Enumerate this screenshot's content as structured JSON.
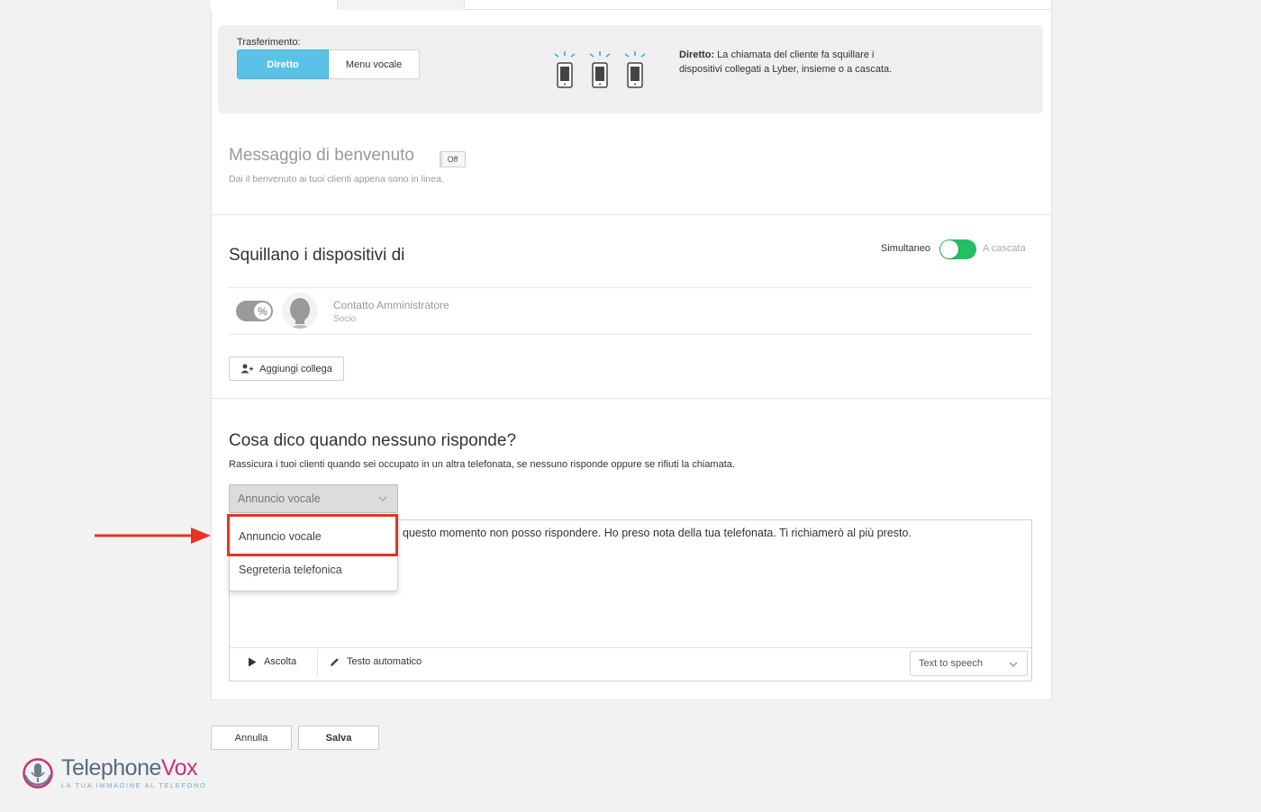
{
  "transfer": {
    "label": "Trasferimento:",
    "options": [
      "Diretto",
      "Menu vocale"
    ],
    "selected": "Diretto",
    "description_bold": "Diretto:",
    "description_rest": " La chiamata del cliente fa squillare i dispositivi collegati a Lyber, insieme o a cascata."
  },
  "welcome": {
    "title": "Messaggio di benvenuto",
    "toggle_label": "Off",
    "subtitle": "Dai il benvenuto ai tuoi clienti appena sono in linea."
  },
  "ring": {
    "title": "Squillano i dispositivi di",
    "mode_left": "Simultaneo",
    "mode_right": "A cascata",
    "simultaneous_on": true,
    "contact": {
      "name": "Contatto Amministratore",
      "role": "Socio"
    },
    "add_button": "Aggiungi collega"
  },
  "no_answer": {
    "title": "Cosa dico quando nessuno risponde?",
    "subtitle": "Rassicura i tuoi clienti quando sei occupato in un altra telefonata, se nessuno risponde oppure se rifiuti la chiamata.",
    "select_value": "Annuncio vocale",
    "dropdown_options": [
      "Annuncio vocale",
      "Segreteria telefonica"
    ],
    "message_text": "questo momento non posso rispondere. Ho preso nota della tua telefonata. Ti richiamerò al più presto.",
    "listen_label": "Ascolta",
    "auto_text_label": "Testo automatico",
    "tts_value": "Text to speech"
  },
  "footer": {
    "cancel": "Annulla",
    "save": "Salva"
  },
  "logo": {
    "name_part1": "Telephone",
    "name_part2": "Vox",
    "tagline": "LA TUA IMMAGINE AL TELEFONO"
  },
  "colors": {
    "accent": "#5bc2e7",
    "toggle_on": "#22c063",
    "highlight": "#e83223",
    "logo_pink": "#c7317a"
  }
}
